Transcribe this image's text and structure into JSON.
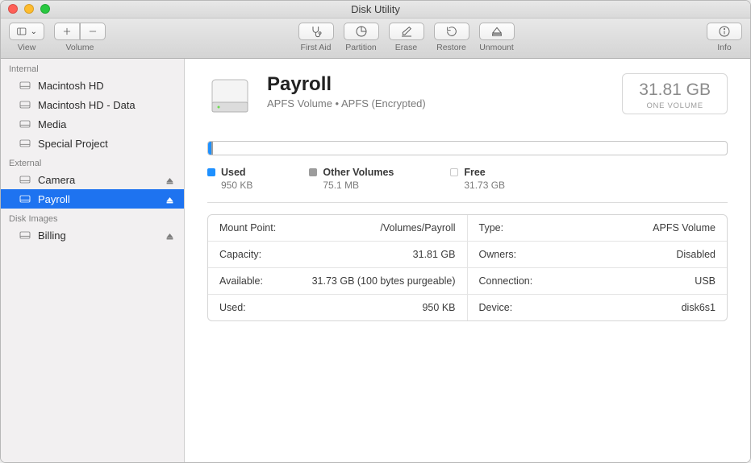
{
  "window": {
    "title": "Disk Utility"
  },
  "toolbar": {
    "view_label": "View",
    "volume_label": "Volume",
    "firstaid_label": "First Aid",
    "partition_label": "Partition",
    "erase_label": "Erase",
    "restore_label": "Restore",
    "unmount_label": "Unmount",
    "info_label": "Info"
  },
  "sidebar": {
    "sections": [
      {
        "header": "Internal",
        "items": [
          {
            "name": "Macintosh HD",
            "ejectable": false
          },
          {
            "name": "Macintosh HD - Data",
            "ejectable": false
          },
          {
            "name": "Media",
            "ejectable": false
          },
          {
            "name": "Special Project",
            "ejectable": false
          }
        ]
      },
      {
        "header": "External",
        "items": [
          {
            "name": "Camera",
            "ejectable": true
          },
          {
            "name": "Payroll",
            "ejectable": true,
            "selected": true
          }
        ]
      },
      {
        "header": "Disk Images",
        "items": [
          {
            "name": "Billing",
            "ejectable": true
          }
        ]
      }
    ]
  },
  "volume": {
    "name": "Payroll",
    "subtitle": "APFS Volume • APFS (Encrypted)",
    "capacity": "31.81 GB",
    "caption": "ONE VOLUME"
  },
  "legend": {
    "used_label": "Used",
    "used_val": "950 KB",
    "other_label": "Other Volumes",
    "other_val": "75.1 MB",
    "free_label": "Free",
    "free_val": "31.73 GB"
  },
  "info": {
    "mount_point_k": "Mount Point:",
    "mount_point_v": "/Volumes/Payroll",
    "type_k": "Type:",
    "type_v": "APFS Volume",
    "capacity_k": "Capacity:",
    "capacity_v": "31.81 GB",
    "owners_k": "Owners:",
    "owners_v": "Disabled",
    "available_k": "Available:",
    "available_v": "31.73 GB (100 bytes purgeable)",
    "connection_k": "Connection:",
    "connection_v": "USB",
    "used_k": "Used:",
    "used_v": "950 KB",
    "device_k": "Device:",
    "device_v": "disk6s1"
  }
}
